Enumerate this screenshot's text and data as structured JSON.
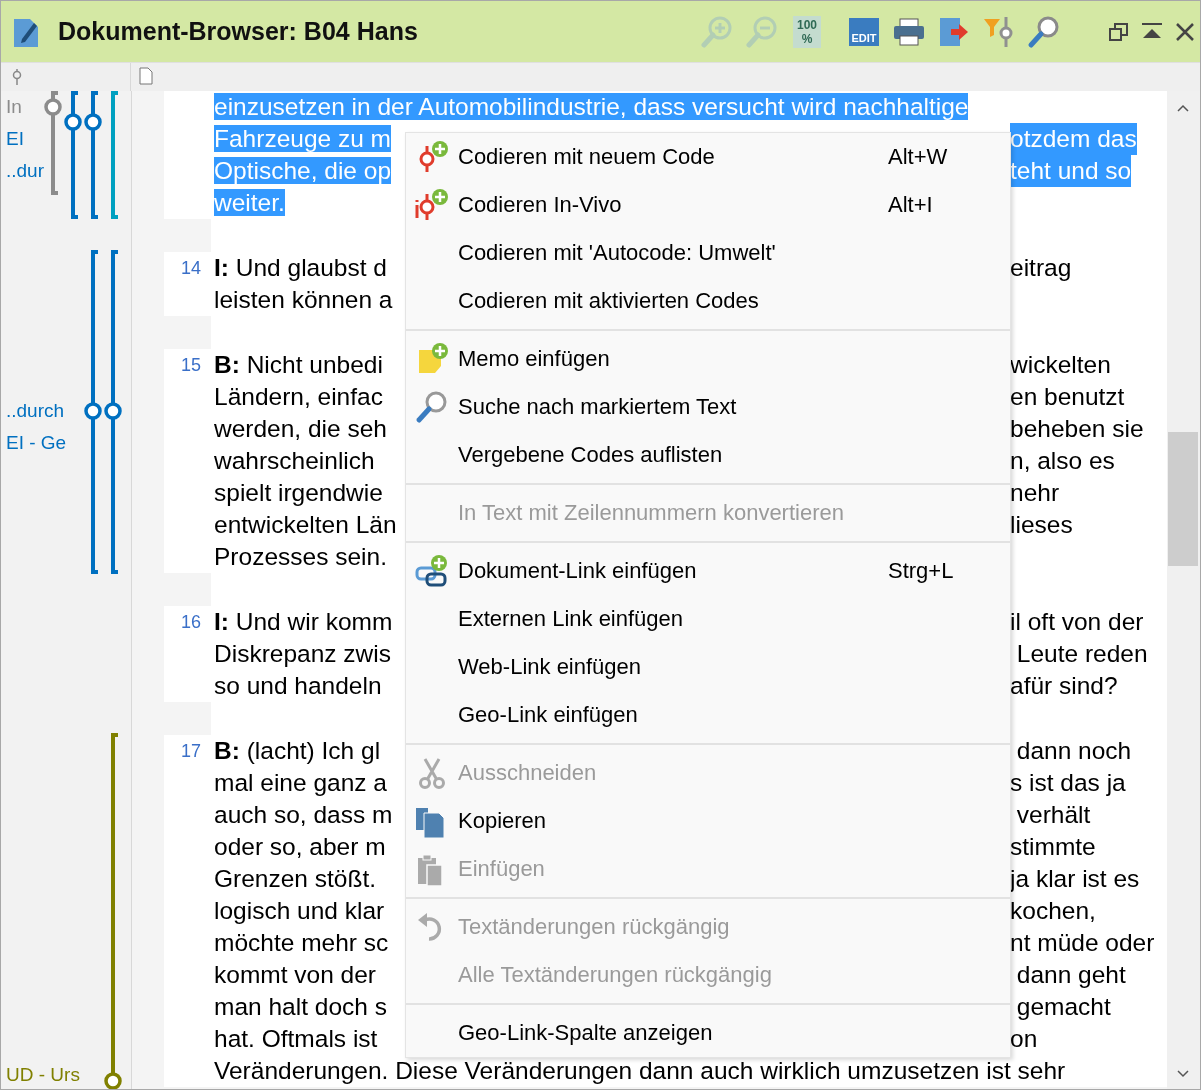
{
  "window": {
    "title": "Dokument-Browser: B04 Hans"
  },
  "toolbar": [
    {
      "kind": "zoom-in",
      "disabled": true
    },
    {
      "kind": "zoom-out",
      "disabled": true
    },
    {
      "kind": "zoom-reset",
      "label": "100 %",
      "disabled": true
    },
    {
      "kind": "edit",
      "label": "EDIT",
      "disabled": false
    },
    {
      "kind": "print",
      "disabled": false
    },
    {
      "kind": "export",
      "disabled": false
    },
    {
      "kind": "filter",
      "disabled": false
    },
    {
      "kind": "search",
      "disabled": false
    }
  ],
  "code_labels": [
    {
      "label": "In",
      "color": "#8c8c8c"
    },
    {
      "label": "EI",
      "color": "#0070c0"
    },
    {
      "label": "..dur",
      "color": "#0070c0"
    },
    {
      "label": "..durch",
      "color": "#0070c0"
    },
    {
      "label": "EI - Ge",
      "color": "#0070c0"
    },
    {
      "label": "UD - Urs",
      "color": "#808000"
    }
  ],
  "code_stripes": [
    {
      "color": "#8c8c8c"
    },
    {
      "color": "#0070c0"
    },
    {
      "color": "#0070c0"
    },
    {
      "color": "#00a0c0"
    },
    {
      "color": "#0070c0"
    },
    {
      "color": "#0070c0"
    },
    {
      "color": "#808000"
    }
  ],
  "paragraphs": [
    {
      "selected": true,
      "lines": [
        {
          "left": "einzusetzen in der Automobilindustrie, dass versucht wird nachhaltige"
        },
        {
          "left": "Fahrzeuge zu m",
          "right": "otzdem das"
        },
        {
          "left": "Optische, die op",
          "right": "teht und so"
        },
        {
          "left": "weiter."
        }
      ]
    },
    {
      "number": "14",
      "selected": false,
      "lines": [
        {
          "left": "**I:** Und glaubst d",
          "right": "eitrag"
        },
        {
          "left": "leisten können a"
        }
      ]
    },
    {
      "number": "15",
      "selected": false,
      "lines": [
        {
          "left": "**B:** Nicht unbedi",
          "right": "wickelten"
        },
        {
          "left": "Ländern, einfac",
          "right": "en benutzt"
        },
        {
          "left": "werden, die seh",
          "right": "beheben sie"
        },
        {
          "left": "wahrscheinlich",
          "right": "n, also es"
        },
        {
          "left": "spielt irgendwie",
          "right": "nehr"
        },
        {
          "left": "entwickelten Län",
          "right": "lieses"
        },
        {
          "left": "Prozesses sein."
        }
      ]
    },
    {
      "number": "16",
      "selected": false,
      "lines": [
        {
          "left": "**I:** Und wir komm",
          "right": "il oft von der"
        },
        {
          "left": "Diskrepanz zwis",
          "right": " Leute reden"
        },
        {
          "left": "so und handeln",
          "right": "afür sind?"
        }
      ]
    },
    {
      "number": "17",
      "selected": false,
      "lines": [
        {
          "left": "**B:** (lacht) Ich gl",
          "right": " dann noch"
        },
        {
          "left": "mal eine ganz a",
          "right": "s ist das ja"
        },
        {
          "left": "auch so, dass m",
          "right": " verhält"
        },
        {
          "left": "oder so, aber m",
          "right": "stimmte"
        },
        {
          "left": "Grenzen stößt.",
          "right": "ja klar ist es"
        },
        {
          "left": "logisch und klar",
          "right": "kochen,"
        },
        {
          "left": "möchte mehr sc",
          "right": "nt müde oder"
        },
        {
          "left": "kommt von der",
          "right": " dann geht"
        },
        {
          "left": "man halt doch s",
          "right": " gemacht"
        },
        {
          "left": "hat. Oftmals ist",
          "right": "on"
        },
        {
          "left": "Veränderungen. Diese Veränderungen dann auch wirklich umzusetzen ist sehr"
        }
      ]
    }
  ],
  "context_menu": [
    {
      "kind": "code",
      "label": "Codieren mit neuem Code",
      "shortcut": "Alt+W",
      "disabled": false
    },
    {
      "kind": "invivo",
      "label": "Codieren In-Vivo",
      "shortcut": "Alt+I",
      "disabled": false
    },
    {
      "kind": "item",
      "label": "Codieren mit 'Autocode: Umwelt'",
      "disabled": false
    },
    {
      "kind": "item",
      "label": "Codieren mit aktivierten Codes",
      "disabled": false
    },
    {
      "kind": "separator"
    },
    {
      "kind": "memo",
      "label": "Memo einfügen",
      "disabled": false
    },
    {
      "kind": "search",
      "label": "Suche nach markiertem Text",
      "disabled": false
    },
    {
      "kind": "item",
      "label": "Vergebene Codes auflisten",
      "disabled": false
    },
    {
      "kind": "separator"
    },
    {
      "kind": "item",
      "label": "In Text mit Zeilennummern konvertieren",
      "disabled": true
    },
    {
      "kind": "separator"
    },
    {
      "kind": "link",
      "label": "Dokument-Link einfügen",
      "shortcut": "Strg+L",
      "disabled": false
    },
    {
      "kind": "item",
      "label": "Externen Link einfügen",
      "disabled": false
    },
    {
      "kind": "item",
      "label": "Web-Link einfügen",
      "disabled": false
    },
    {
      "kind": "item",
      "label": "Geo-Link einfügen",
      "disabled": false
    },
    {
      "kind": "separator"
    },
    {
      "kind": "cut",
      "label": "Ausschneiden",
      "disabled": true
    },
    {
      "kind": "copy",
      "label": "Kopieren",
      "disabled": false
    },
    {
      "kind": "paste",
      "label": "Einfügen",
      "disabled": true
    },
    {
      "kind": "separator"
    },
    {
      "kind": "undo",
      "label": "Textänderungen rückgängig",
      "disabled": true
    },
    {
      "kind": "item",
      "label": "Alle Textänderungen rückgängig",
      "disabled": true
    },
    {
      "kind": "separator"
    },
    {
      "kind": "item",
      "label": "Geo-Link-Spalte anzeigen",
      "disabled": false
    }
  ]
}
